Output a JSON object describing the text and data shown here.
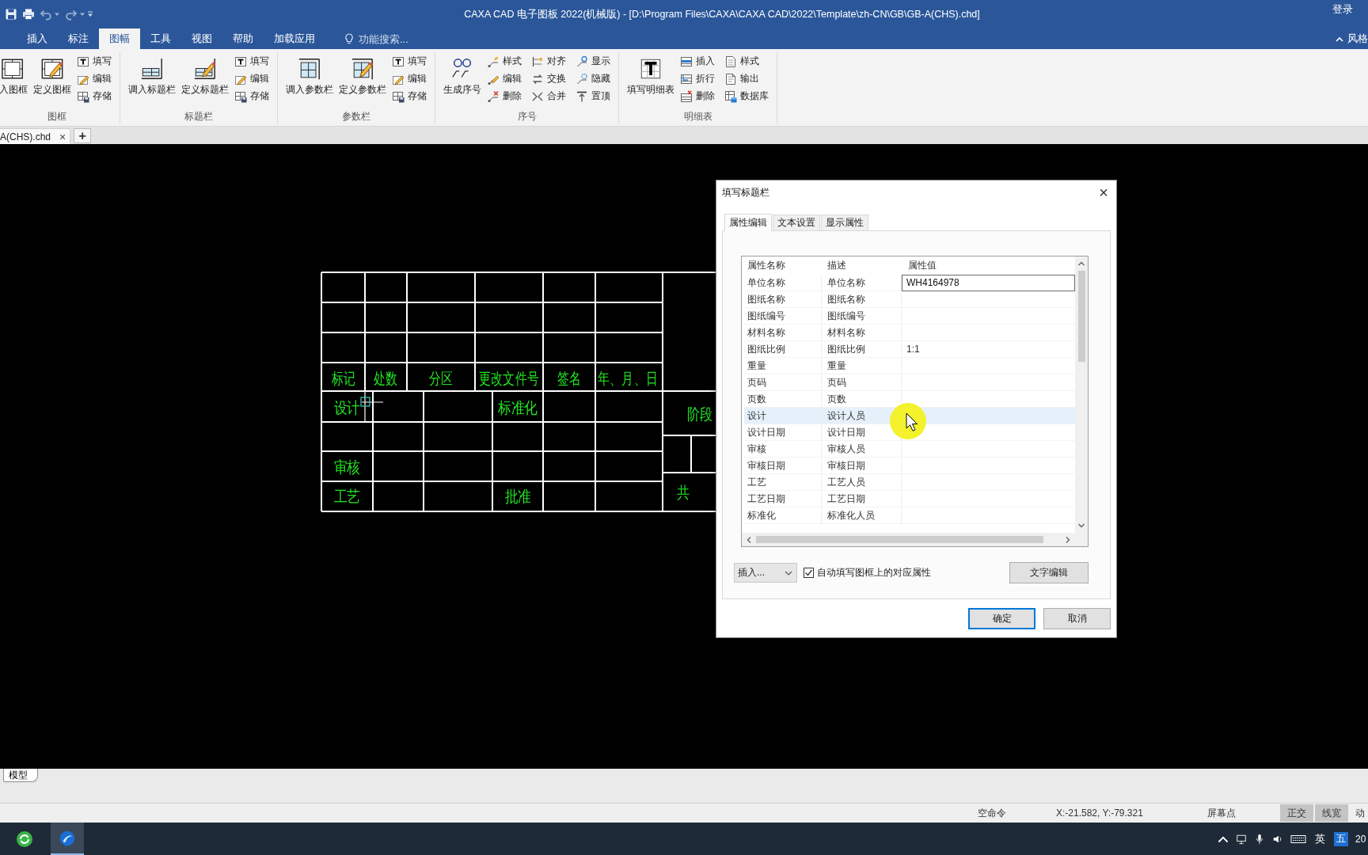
{
  "window": {
    "title": "CAXA CAD 电子图板 2022(机械版) - [D:\\Program Files\\CAXA\\CAXA CAD\\2022\\Template\\zh-CN\\GB\\GB-A(CHS).chd]",
    "login": "登录"
  },
  "ribbon_tabs": [
    {
      "label": "插入",
      "selected": false
    },
    {
      "label": "标注",
      "selected": false
    },
    {
      "label": "图幅",
      "selected": true
    },
    {
      "label": "工具",
      "selected": false
    },
    {
      "label": "视图",
      "selected": false
    },
    {
      "label": "帮助",
      "selected": false
    },
    {
      "label": "加载应用",
      "selected": false
    }
  ],
  "search": {
    "placeholder": "功能搜索..."
  },
  "style_toggle": "风格",
  "ribbon_groups": [
    {
      "label": "图框",
      "large": [
        "入图框",
        "定义图框"
      ],
      "small": [
        "填写",
        "编辑",
        "存储"
      ]
    },
    {
      "label": "标题栏",
      "large": [
        "调入标题栏",
        "定义标题栏"
      ],
      "small": [
        "填写",
        "编辑",
        "存储"
      ]
    },
    {
      "label": "参数栏",
      "large": [
        "调入参数栏",
        "定义参数栏"
      ],
      "small": [
        "填写",
        "编辑",
        "存储"
      ]
    },
    {
      "label": "序号",
      "large": [
        "生成序号"
      ],
      "small": [
        "样式",
        "编辑",
        "删除",
        "对齐",
        "交换",
        "合并",
        "显示",
        "隐藏",
        "置顶"
      ]
    },
    {
      "label": "明细表",
      "large": [
        "填写明细表"
      ],
      "small": [
        "插入",
        "折行",
        "删除",
        "样式",
        "输出",
        "数据库"
      ]
    }
  ],
  "document_tabs": [
    {
      "label": "A(CHS).chd",
      "close": "×",
      "selected": true
    }
  ],
  "new_tab": "+",
  "title_block": {
    "change_headings": [
      "标记",
      "处数",
      "分区",
      "更改文件号",
      "签名",
      "年、月、日"
    ],
    "signatures": [
      "设计",
      "标准化",
      "审核",
      "工艺",
      "批准"
    ],
    "side_labels": [
      "阶段",
      "共"
    ]
  },
  "dialog": {
    "title": "填写标题栏",
    "close": "×",
    "tabs": [
      {
        "label": "属性编辑",
        "selected": true
      },
      {
        "label": "文本设置",
        "selected": false
      },
      {
        "label": "显示属性",
        "selected": false
      }
    ],
    "grid": {
      "columns": [
        "属性名称",
        "描述",
        "属性值"
      ],
      "rows": [
        {
          "name": "单位名称",
          "description": "单位名称",
          "value": "WH4164978",
          "editing": true,
          "selected": false
        },
        {
          "name": "图纸名称",
          "description": "图纸名称",
          "editing": false,
          "selected": false
        },
        {
          "name": "图纸编号",
          "description": "图纸编号",
          "editing": false,
          "selected": false
        },
        {
          "name": "材料名称",
          "description": "材料名称",
          "editing": false,
          "selected": false
        },
        {
          "name": "图纸比例",
          "description": "图纸比例",
          "value": "1:1",
          "editing": false,
          "selected": false
        },
        {
          "name": "重量",
          "description": "重量",
          "editing": false,
          "selected": false
        },
        {
          "name": "页码",
          "description": "页码",
          "editing": false,
          "selected": false
        },
        {
          "name": "页数",
          "description": "页数",
          "editing": false,
          "selected": false
        },
        {
          "name": "设计",
          "description": "设计人员",
          "editing": false,
          "selected": true
        },
        {
          "name": "设计日期",
          "description": "设计日期",
          "editing": false,
          "selected": false
        },
        {
          "name": "审核",
          "description": "审核人员",
          "editing": false,
          "selected": false
        },
        {
          "name": "审核日期",
          "description": "审核日期",
          "editing": false,
          "selected": false
        },
        {
          "name": "工艺",
          "description": "工艺人员",
          "editing": false,
          "selected": false
        },
        {
          "name": "工艺日期",
          "description": "工艺日期",
          "editing": false,
          "selected": false
        },
        {
          "name": "标准化",
          "description": "标准化人员",
          "editing": false,
          "selected": false
        }
      ]
    },
    "insert_dropdown": "插入...",
    "auto_fill": {
      "label": "自动填写图框上的对应属性",
      "checked": true
    },
    "text_edit_button": "文字编辑",
    "buttons": [
      {
        "label": "确定",
        "default": true
      },
      {
        "label": "取消",
        "default": false
      }
    ]
  },
  "layout_tabs": [
    {
      "label": "模型",
      "selected": true
    }
  ],
  "status_bar": {
    "command": "空命令",
    "coordinates": "X:-21.582, Y:-79.321",
    "snap_mode": "屏幕点",
    "toggles": [
      {
        "label": "正交",
        "on": true
      },
      {
        "label": "线宽",
        "on": true
      },
      {
        "label": "动",
        "on": false
      }
    ]
  },
  "taskbar": {
    "language": "英",
    "input_mode": "五",
    "clock": "20"
  }
}
